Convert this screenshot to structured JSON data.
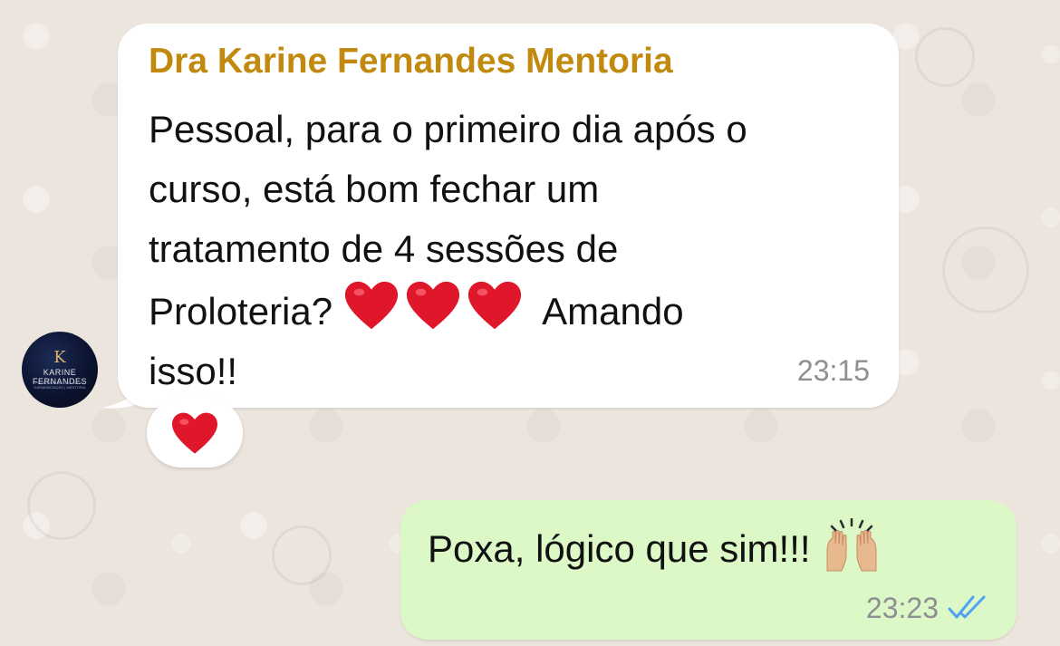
{
  "incoming": {
    "sender": "Dra Karine Fernandes Mentoria",
    "text_lines": [
      "Pessoal, para o primeiro dia após o",
      "curso, está bom fechar um",
      "tratamento de 4 sessões de"
    ],
    "line4_before": "Proloteria?",
    "line4_after": "Amando",
    "line5": "isso!!",
    "time": "23:15",
    "reaction": "heart",
    "inline_emojis": [
      "heart",
      "heart",
      "heart"
    ]
  },
  "avatar": {
    "monogram": "K",
    "brand": "KARINE FERNANDES",
    "tagline": "PROFISSIONAL EM SAÚDE | HARMONIZAÇÃO | MENTORIA"
  },
  "outgoing": {
    "text": "Poxa, lógico que sim!!!",
    "emoji": "raised-hands",
    "time": "23:23",
    "status": "read"
  },
  "colors": {
    "background": "#ECE5DD",
    "incoming_bubble": "#FFFFFF",
    "outgoing_bubble": "#DCF8C6",
    "sender_name": "#C18A0E",
    "timestamp": "#8E8E93",
    "read_ticks": "#4FA3F7",
    "heart": "#E0162B"
  }
}
